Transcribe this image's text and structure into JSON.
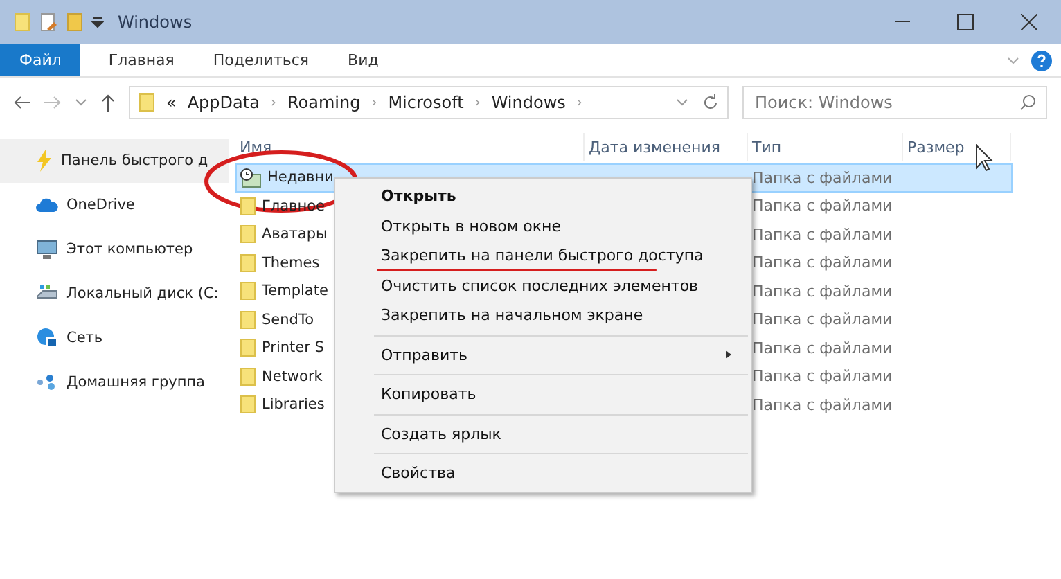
{
  "window": {
    "title": "Windows"
  },
  "ribbon_tabs": [
    {
      "label": "Файл",
      "selected": true
    },
    {
      "label": "Главная",
      "selected": false
    },
    {
      "label": "Поделиться",
      "selected": false
    },
    {
      "label": "Вид",
      "selected": false
    }
  ],
  "address": {
    "overflow": "«",
    "path": [
      {
        "label": "AppData",
        "sep": "›"
      },
      {
        "label": "Roaming",
        "sep": "›"
      },
      {
        "label": "Microsoft",
        "sep": "›"
      },
      {
        "label": "Windows",
        "sep": "›"
      }
    ]
  },
  "search": {
    "placeholder": "Поиск: Windows"
  },
  "nav": [
    {
      "label": "Панель быстрого д",
      "kind": "quick",
      "selected": true
    },
    {
      "label": "OneDrive",
      "kind": "cloud",
      "selected": false
    },
    {
      "label": "Этот компьютер",
      "kind": "computer",
      "selected": false
    },
    {
      "label": "Локальный диск (C:",
      "kind": "drive",
      "selected": false
    },
    {
      "label": "Сеть",
      "kind": "network",
      "selected": false
    },
    {
      "label": "Домашняя группа",
      "kind": "homegroup",
      "selected": false
    }
  ],
  "columns": [
    "Имя",
    "Дата изменения",
    "Тип",
    "Размер"
  ],
  "rows": [
    {
      "name": "Недавни",
      "type": "Папка с файлами",
      "kind": "recent",
      "selected": true,
      "circled": true
    },
    {
      "name": "Главное",
      "type": "Папка с файлами",
      "kind": "folder",
      "selected": false,
      "circled": false
    },
    {
      "name": "Аватары",
      "type": "Папка с файлами",
      "kind": "folder",
      "selected": false,
      "circled": false
    },
    {
      "name": "Themes",
      "type": "Папка с файлами",
      "kind": "folder",
      "selected": false,
      "circled": false
    },
    {
      "name": "Template",
      "type": "Папка с файлами",
      "kind": "folder",
      "selected": false,
      "circled": false
    },
    {
      "name": "SendTo",
      "type": "Папка с файлами",
      "kind": "folder",
      "selected": false,
      "circled": false
    },
    {
      "name": "Printer S",
      "type": "Папка с файлами",
      "kind": "folder",
      "selected": false,
      "circled": false
    },
    {
      "name": "Network",
      "type": "Папка с файлами",
      "kind": "folder",
      "selected": false,
      "circled": false
    },
    {
      "name": "Libraries",
      "type": "Папка с файлами",
      "kind": "folder",
      "selected": false,
      "circled": false
    }
  ],
  "context_menu": [
    {
      "kind": "item",
      "label": "Открыть",
      "default": true,
      "submenu": false,
      "underlined": false
    },
    {
      "kind": "item",
      "label": "Открыть в новом окне",
      "default": false,
      "submenu": false,
      "underlined": false
    },
    {
      "kind": "item",
      "label": "Закрепить на панели быстрого доступа",
      "default": false,
      "submenu": false,
      "underlined": true
    },
    {
      "kind": "item",
      "label": "Очистить список последних элементов",
      "default": false,
      "submenu": false,
      "underlined": false
    },
    {
      "kind": "item",
      "label": "Закрепить на начальном экране",
      "default": false,
      "submenu": false,
      "underlined": false
    },
    {
      "kind": "separator"
    },
    {
      "kind": "item",
      "label": "Отправить",
      "default": false,
      "submenu": true,
      "underlined": false
    },
    {
      "kind": "separator"
    },
    {
      "kind": "item",
      "label": "Копировать",
      "default": false,
      "submenu": false,
      "underlined": false
    },
    {
      "kind": "separator"
    },
    {
      "kind": "item",
      "label": "Создать ярлык",
      "default": false,
      "submenu": false,
      "underlined": false
    },
    {
      "kind": "separator"
    },
    {
      "kind": "item",
      "label": "Свойства",
      "default": false,
      "submenu": false,
      "underlined": false
    }
  ]
}
